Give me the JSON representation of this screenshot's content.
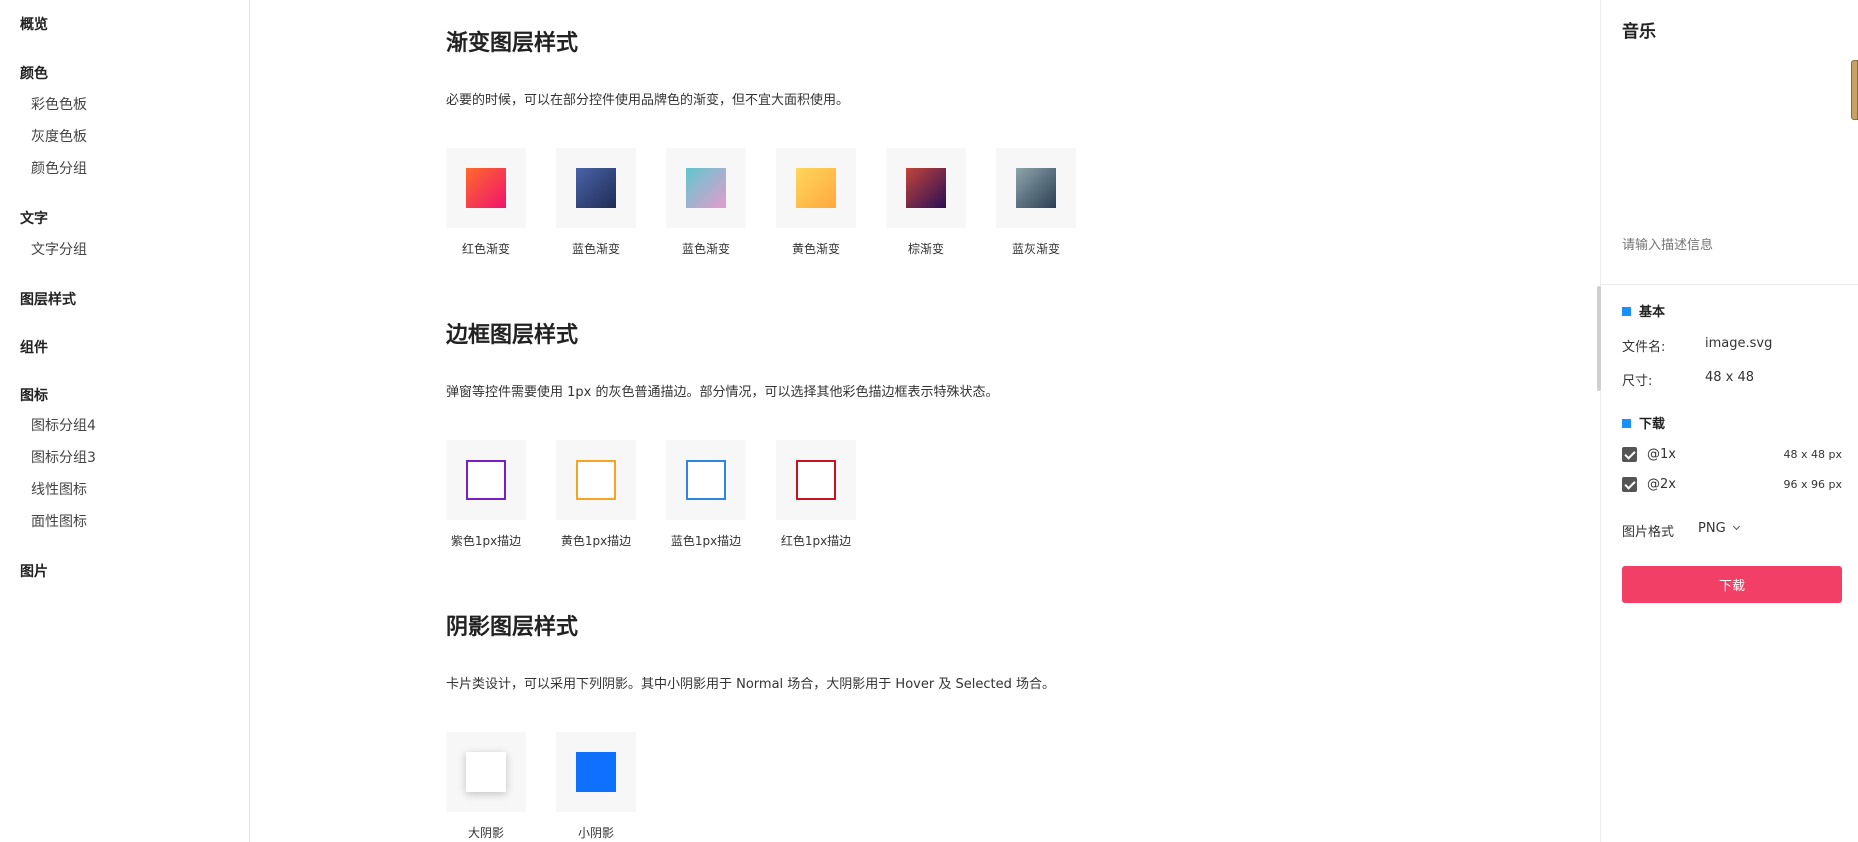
{
  "sidebar": {
    "groups": [
      {
        "label": "概览"
      },
      {
        "label": "颜色",
        "items": [
          "彩色色板",
          "灰度色板",
          "颜色分组"
        ]
      },
      {
        "label": "文字",
        "items": [
          "文字分组"
        ]
      },
      {
        "label": "图层样式"
      },
      {
        "label": "组件"
      },
      {
        "label": "图标",
        "items": [
          "图标分组4",
          "图标分组3",
          "线性图标",
          "面性图标"
        ]
      },
      {
        "label": "图片"
      }
    ]
  },
  "main": {
    "gradient": {
      "title": "渐变图层样式",
      "desc": "必要的时候，可以在部分控件使用品牌色的渐变，但不宜大面积使用。",
      "swatches": [
        {
          "label": "红色渐变",
          "from": "#ff6a2b",
          "to": "#f0136d"
        },
        {
          "label": "蓝色渐变",
          "from": "#4a64a8",
          "to": "#1f2c55"
        },
        {
          "label": "蓝色渐变",
          "from": "#5fc7cf",
          "to": "#e49bcc"
        },
        {
          "label": "黄色渐变",
          "from": "#ffd65c",
          "to": "#ffa83d"
        },
        {
          "label": "棕渐变",
          "from": "#c2453a",
          "to": "#2a0f55"
        },
        {
          "label": "蓝灰渐变",
          "from": "#8da5aa",
          "to": "#2c3e55"
        }
      ]
    },
    "border": {
      "title": "边框图层样式",
      "desc": "弹窗等控件需要使用 1px 的灰色普通描边。部分情况，可以选择其他彩色描边框表示特殊状态。",
      "swatches": [
        {
          "label": "紫色1px描边",
          "color": "#7b1fbf"
        },
        {
          "label": "黄色1px描边",
          "color": "#f5a524"
        },
        {
          "label": "蓝色1px描边",
          "color": "#2e86de"
        },
        {
          "label": "红色1px描边",
          "color": "#c4161c"
        }
      ]
    },
    "shadow": {
      "title": "阴影图层样式",
      "desc": "卡片类设计，可以采用下列阴影。其中小阴影用于 Normal 场合，大阴影用于 Hover 及 Selected 场合。",
      "swatches": [
        {
          "label": "大阴影",
          "color": "#ffffff"
        },
        {
          "label": "小阴影",
          "color": "#0f6fff"
        }
      ]
    }
  },
  "panel": {
    "title": "音乐",
    "desc_placeholder": "请输入描述信息",
    "basic": {
      "heading": "基本",
      "filename_key": "文件名:",
      "filename_val": "image.svg",
      "size_key": "尺寸:",
      "size_val": "48 x 48"
    },
    "download": {
      "heading": "下载",
      "options": [
        {
          "label": "@1x",
          "size": "48 x 48 px",
          "checked": true
        },
        {
          "label": "@2x",
          "size": "96 x 96 px",
          "checked": true
        }
      ],
      "format_key": "图片格式",
      "format_val": "PNG",
      "button": "下载"
    },
    "accent": "#1890ff",
    "button_color": "#f23f66"
  }
}
